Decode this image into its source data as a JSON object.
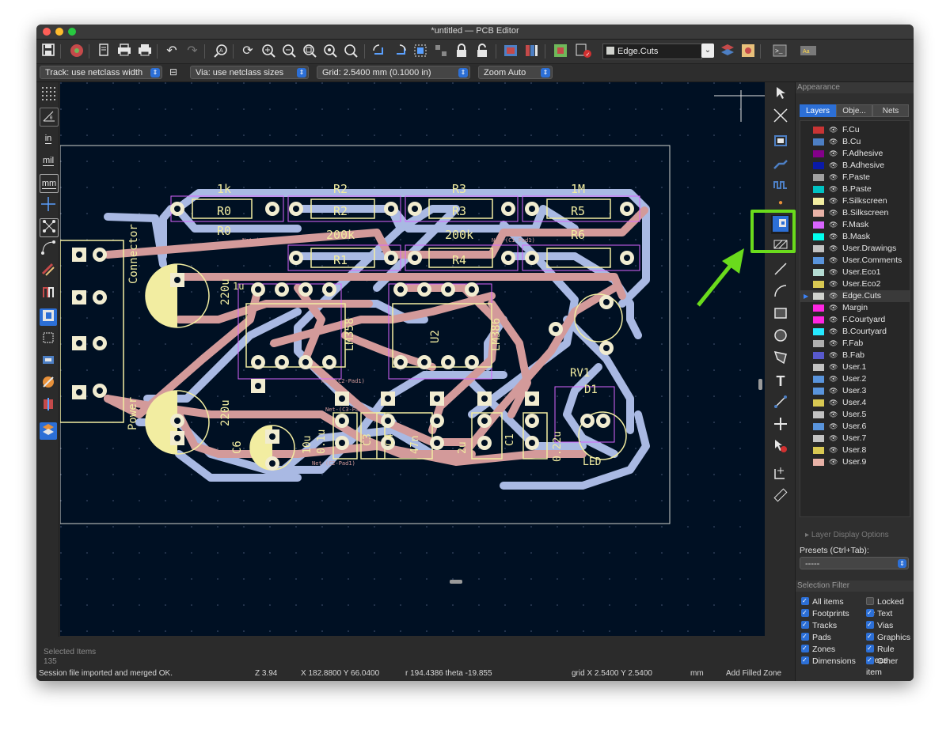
{
  "window": {
    "title": "*untitled — PCB Editor"
  },
  "toolbar": {
    "layer_select": "Edge.Cuts"
  },
  "options_bar": {
    "track": "Track: use netclass width",
    "via": "Via: use netclass sizes",
    "grid": "Grid: 2.5400 mm (0.1000 in)",
    "zoom": "Zoom Auto"
  },
  "left_tools": {
    "in": "in",
    "mil": "mil",
    "mm": "mm"
  },
  "appearance": {
    "header": "Appearance",
    "tabs": [
      "Layers",
      "Obje...",
      "Nets"
    ],
    "layers": [
      {
        "name": "F.Cu",
        "color": "#c83434"
      },
      {
        "name": "B.Cu",
        "color": "#4d7fc4"
      },
      {
        "name": "F.Adhesive",
        "color": "#84008a"
      },
      {
        "name": "B.Adhesive",
        "color": "#0a1aa8"
      },
      {
        "name": "F.Paste",
        "color": "#a0a0a0"
      },
      {
        "name": "B.Paste",
        "color": "#00c2c2"
      },
      {
        "name": "F.Silkscreen",
        "color": "#f2eda1"
      },
      {
        "name": "B.Silkscreen",
        "color": "#e8b2a7"
      },
      {
        "name": "F.Mask",
        "color": "#d864ff"
      },
      {
        "name": "B.Mask",
        "color": "#02ffee"
      },
      {
        "name": "User.Drawings",
        "color": "#c2c2c2"
      },
      {
        "name": "User.Comments",
        "color": "#5994dc"
      },
      {
        "name": "User.Eco1",
        "color": "#b4dbd2"
      },
      {
        "name": "User.Eco2",
        "color": "#d8c852"
      },
      {
        "name": "Edge.Cuts",
        "color": "#d0d2cd"
      },
      {
        "name": "Margin",
        "color": "#ff26e2"
      },
      {
        "name": "F.Courtyard",
        "color": "#ff26e2"
      },
      {
        "name": "B.Courtyard",
        "color": "#26e9ff"
      },
      {
        "name": "F.Fab",
        "color": "#afafaf"
      },
      {
        "name": "B.Fab",
        "color": "#5859cc"
      },
      {
        "name": "User.1",
        "color": "#c2c2c2"
      },
      {
        "name": "User.2",
        "color": "#5994dc"
      },
      {
        "name": "User.3",
        "color": "#5994dc"
      },
      {
        "name": "User.4",
        "color": "#d8c852"
      },
      {
        "name": "User.5",
        "color": "#c2c2c2"
      },
      {
        "name": "User.6",
        "color": "#5994dc"
      },
      {
        "name": "User.7",
        "color": "#c2c2c2"
      },
      {
        "name": "User.8",
        "color": "#d8c852"
      },
      {
        "name": "User.9",
        "color": "#e8b2a7"
      }
    ],
    "current_layer": "Edge.Cuts",
    "layer_display_options": "Layer Display Options",
    "presets_label": "Presets (Ctrl+Tab):",
    "presets_value": "-----"
  },
  "selection_filter": {
    "header": "Selection Filter",
    "items": [
      {
        "label": "All items",
        "checked": true
      },
      {
        "label": "Locked ite",
        "checked": false
      },
      {
        "label": "Footprints",
        "checked": true
      },
      {
        "label": "Text",
        "checked": true
      },
      {
        "label": "Tracks",
        "checked": true
      },
      {
        "label": "Vias",
        "checked": true
      },
      {
        "label": "Pads",
        "checked": true
      },
      {
        "label": "Graphics",
        "checked": true
      },
      {
        "label": "Zones",
        "checked": true
      },
      {
        "label": "Rule Areas",
        "checked": true
      },
      {
        "label": "Dimensions",
        "checked": true
      },
      {
        "label": "Other item",
        "checked": true
      }
    ]
  },
  "status": {
    "selected_label": "Selected Items",
    "selected_count": "135",
    "message": "Session file imported and merged OK.",
    "zoom": "Z 3.94",
    "xy": "X 182.8800  Y 66.0400",
    "polar": "r 194.4386  theta -19.855",
    "grid": "grid X 2.5400  Y 2.5400",
    "units": "mm",
    "mode": "Add Filled Zone"
  },
  "pcb": {
    "resistors": [
      {
        "ref": "R0",
        "value": "1k"
      },
      {
        "ref": "R2",
        "value": "R2"
      },
      {
        "ref": "R3",
        "value": "R3"
      },
      {
        "ref": "R5",
        "value": "1M"
      },
      {
        "ref": "R1",
        "value": "200k"
      },
      {
        "ref": "R4",
        "value": "200k"
      },
      {
        "ref": "R6",
        "value": "R6"
      }
    ],
    "labels": {
      "r0_below": "R0",
      "u1": "LM358",
      "u2": "U2",
      "u2_val": "LM386",
      "rv1": "RV1",
      "d1": "D1",
      "led": "LED",
      "c6": "C6",
      "c6_val": "220u",
      "c2_val": "220u",
      "c_10u": "10u",
      "c_01u": "0.1u",
      "c3": "C3",
      "c4": "C4",
      "c_47n": "47n",
      "c_2u": "2u",
      "c1": "C1",
      "c_022u": "0.22u",
      "j_power": "Power",
      "j_conn": "Connector",
      "u_label": "1u",
      "net1": "Net-(C1-Pad1)",
      "net2": "Net-(C2-Pad1)",
      "net_amp": "Amp Input",
      "net3": "Net-(C3-Pad1)"
    }
  },
  "colors": {
    "canvas_bg": "#001023",
    "front_copper": "#d39a9a",
    "back_copper": "#a9b9e3",
    "pad": "#f1ecd0",
    "highlight": "#6adb1c"
  }
}
